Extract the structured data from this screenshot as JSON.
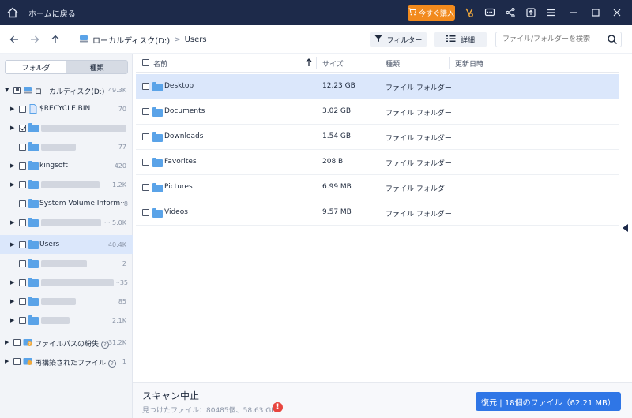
{
  "titlebar": {
    "back_label": "ホームに戻る",
    "buy_label": "今すぐ購入",
    "icons": [
      "home-icon",
      "cart-icon",
      "discount-icon",
      "chat-icon",
      "share-icon",
      "export-icon",
      "menu-icon",
      "minimize-icon",
      "maximize-icon",
      "close-icon"
    ]
  },
  "toolbar": {
    "path_drive": "ローカルディスク(D:)",
    "path_sep": ">",
    "path_folder": "Users",
    "filter_label": "フィルター",
    "details_label": "詳細",
    "search_placeholder": "ファイル/フォルダーを検索"
  },
  "sidebar": {
    "tabs": [
      "フォルダ",
      "種類"
    ],
    "tree": [
      {
        "label": "ローカルディスク(D:)",
        "count": "49.3K"
      },
      {
        "label": "$RECYCLE.BIN",
        "count": "70"
      },
      {
        "label": "",
        "count": ""
      },
      {
        "label": "",
        "count": "77"
      },
      {
        "label": "kingsoft",
        "count": "420"
      },
      {
        "label": "",
        "count": "1.2K"
      },
      {
        "label": "System Volume Inform···",
        "count": "8"
      },
      {
        "label": "",
        "count": "··· 5.0K"
      },
      {
        "label": "Users",
        "count": "40.4K"
      },
      {
        "label": "",
        "count": "2"
      },
      {
        "label": "",
        "count": "··35"
      },
      {
        "label": "",
        "count": "85"
      },
      {
        "label": "",
        "count": "2.1K"
      },
      {
        "label": "ファイルパスの紛失",
        "count": "31.2K"
      },
      {
        "label": "再構築されたファイル",
        "count": "1"
      }
    ]
  },
  "table": {
    "headers": {
      "name": "名前",
      "size": "サイズ",
      "type": "種類",
      "modified": "更新日時"
    },
    "rows": [
      {
        "name": "Desktop",
        "size": "12.23 GB",
        "type": "ファイル フォルダー",
        "modified": ""
      },
      {
        "name": "Documents",
        "size": "3.02 GB",
        "type": "ファイル フォルダー",
        "modified": ""
      },
      {
        "name": "Downloads",
        "size": "1.54 GB",
        "type": "ファイル フォルダー",
        "modified": ""
      },
      {
        "name": "Favorites",
        "size": "208 B",
        "type": "ファイル フォルダー",
        "modified": ""
      },
      {
        "name": "Pictures",
        "size": "6.99 MB",
        "type": "ファイル フォルダー",
        "modified": ""
      },
      {
        "name": "Videos",
        "size": "9.57 MB",
        "type": "ファイル フォルダー",
        "modified": ""
      }
    ]
  },
  "footer": {
    "status_title": "スキャン中止",
    "status_sub": "見つけたファイル：80485個、58.63 GB",
    "warn_glyph": "!",
    "recover_label": "復元 | 18個のファイル（62.21 MB）"
  },
  "colors": {
    "titlebar_bg": "#1d2a4a",
    "buy_orange": "#f28a1d",
    "accent_blue": "#2f76e6",
    "selected_row": "#dbe7fb",
    "folder_blue": "#5aa3e8",
    "warn_red": "#e8463f"
  }
}
